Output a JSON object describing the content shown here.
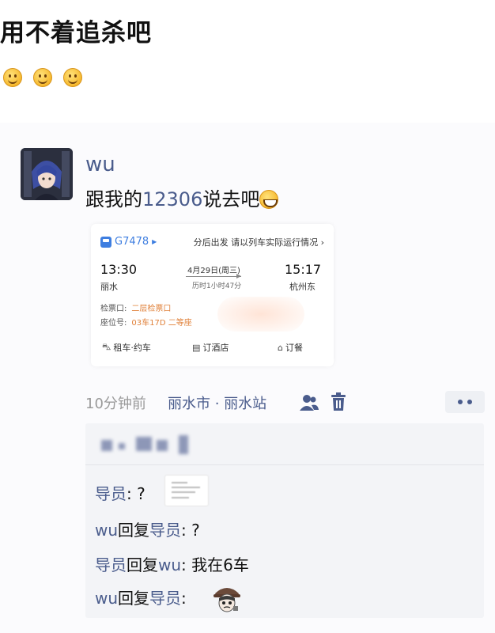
{
  "caption": "用不着追杀吧",
  "emoji_row": [
    "smiley-emoji",
    "smiley-emoji",
    "smiley-emoji"
  ],
  "post": {
    "username": "wu",
    "text_before": "跟我的",
    "text_number": "12306",
    "text_after": "说去吧",
    "text_emoji": "grin-emoji"
  },
  "ticket": {
    "train_no": "G7478",
    "notice": "分后出发 请以列车实际运行情况 ›",
    "depart_time": "13:30",
    "depart_station": "丽水",
    "arrive_time": "15:17",
    "arrive_station": "杭州东",
    "date": "4月29日(周三)",
    "duration": "历时1小时47分",
    "gate_label": "检票口:",
    "gate_value": "二层检票口",
    "seat_label": "座位号:",
    "seat_value": "03车17D 二等座",
    "services": [
      "租车·约车",
      "订酒店",
      "订餐"
    ]
  },
  "meta": {
    "time": "10分钟前",
    "location": "丽水市 · 丽水站"
  },
  "comments": [
    {
      "who": "导员",
      "reply_to": "",
      "text": ": ?"
    },
    {
      "who": "wu",
      "reply_word": "回复",
      "reply_to": "导员",
      "text": ": ?"
    },
    {
      "who": "导员",
      "reply_word": "回复",
      "reply_to": "wu",
      "text": ": 我在6车"
    },
    {
      "who": "wu",
      "reply_word": "回复",
      "reply_to": "导员",
      "text": ":"
    }
  ],
  "colors": {
    "link_blue": "#4a5c8c",
    "ticket_blue": "#3e7ee0",
    "ticket_orange": "#e0813a"
  }
}
